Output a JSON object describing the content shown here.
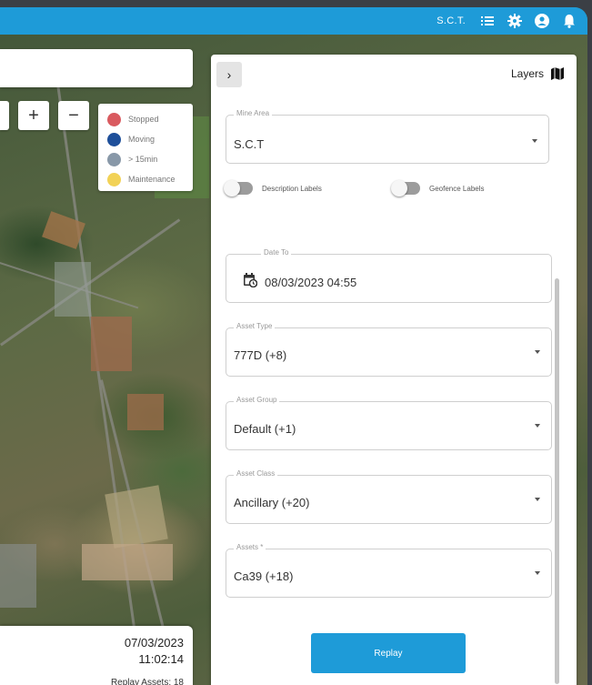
{
  "topbar": {
    "org_label": "S.C.T.",
    "icons": [
      "list-icon",
      "gear-icon",
      "account-icon",
      "bell-icon"
    ]
  },
  "map": {
    "zoom_in_label": "+",
    "zoom_out_label": "−",
    "legend": [
      {
        "label": "Stopped",
        "color": "#d95a5f"
      },
      {
        "label": "Moving",
        "color": "#1e4f9a"
      },
      {
        "label": "> 15min",
        "color": "#8898a8"
      },
      {
        "label": "Maintenance",
        "color": "#f2d256"
      }
    ],
    "info": {
      "date": "07/03/2023",
      "time": "11:02:14",
      "replay_assets": "Replay Assets: 18"
    }
  },
  "panel": {
    "collapse_label": "›",
    "layers_label": "Layers",
    "mine_area": {
      "label": "Mine Area",
      "value": "S.C.T"
    },
    "toggles": {
      "description": "Description Labels",
      "geofence": "Geofence Labels"
    },
    "date_to": {
      "label": "Date To",
      "value": "08/03/2023 04:55"
    },
    "asset_type": {
      "label": "Asset Type",
      "value": "777D (+8)"
    },
    "asset_group": {
      "label": "Asset Group",
      "value": "Default (+1)"
    },
    "asset_class": {
      "label": "Asset Class",
      "value": "Ancillary (+20)"
    },
    "assets": {
      "label": "Assets *",
      "value": "Ca39 (+18)"
    },
    "replay_label": "Replay"
  },
  "colors": {
    "accent": "#1e9bd8"
  }
}
